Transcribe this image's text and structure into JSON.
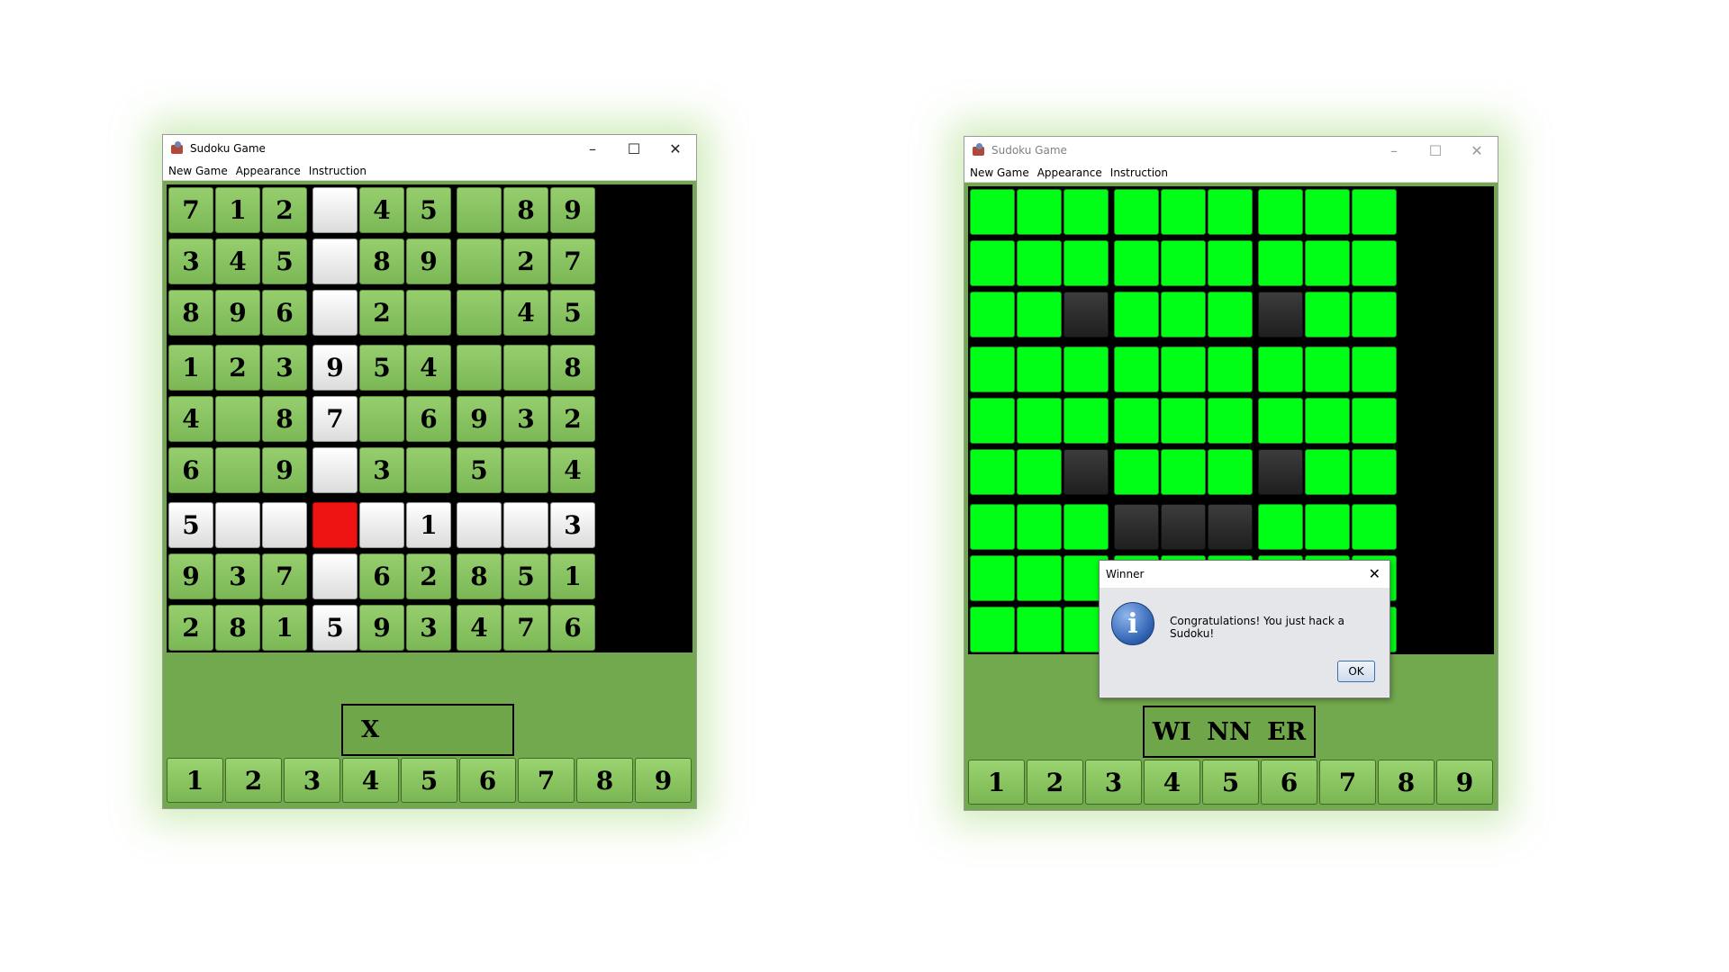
{
  "left_window": {
    "title": "Sudoku Game",
    "menu": [
      "New Game",
      "Appearance",
      "Instruction"
    ],
    "controls": [
      "–",
      "☐",
      "✕"
    ],
    "board": [
      [
        "7",
        "1",
        "2",
        "",
        "4",
        "5",
        "",
        "8",
        "9"
      ],
      [
        "3",
        "4",
        "5",
        "",
        "8",
        "9",
        "",
        "2",
        "7"
      ],
      [
        "8",
        "9",
        "6",
        "",
        "2",
        "",
        "",
        "4",
        "5"
      ],
      [
        "1",
        "2",
        "3",
        "9",
        "5",
        "4",
        "",
        "",
        "8"
      ],
      [
        "4",
        "",
        "8",
        "7",
        "",
        "6",
        "9",
        "3",
        "2"
      ],
      [
        "6",
        "",
        "9",
        "",
        "3",
        "",
        "5",
        "",
        "4"
      ],
      [
        "5",
        "",
        "",
        "",
        "",
        "1",
        "",
        "",
        "3"
      ],
      [
        "9",
        "3",
        "7",
        "",
        "6",
        "2",
        "8",
        "5",
        "1"
      ],
      [
        "2",
        "8",
        "1",
        "5",
        "9",
        "3",
        "4",
        "7",
        "6"
      ]
    ],
    "cell_styles": [
      [
        "g",
        "g",
        "g",
        "w",
        "g",
        "g",
        "g",
        "g",
        "g"
      ],
      [
        "g",
        "g",
        "g",
        "w",
        "g",
        "g",
        "g",
        "g",
        "g"
      ],
      [
        "g",
        "g",
        "g",
        "w",
        "g",
        "g",
        "g",
        "g",
        "g"
      ],
      [
        "g",
        "g",
        "g",
        "w",
        "g",
        "g",
        "g",
        "g",
        "g"
      ],
      [
        "g",
        "g",
        "g",
        "w",
        "g",
        "g",
        "g",
        "g",
        "g"
      ],
      [
        "g",
        "g",
        "g",
        "w",
        "g",
        "g",
        "g",
        "g",
        "g"
      ],
      [
        "w",
        "w",
        "w",
        "r",
        "w",
        "w",
        "w",
        "w",
        "w"
      ],
      [
        "g",
        "g",
        "g",
        "w",
        "g",
        "g",
        "g",
        "g",
        "g"
      ],
      [
        "g",
        "g",
        "g",
        "w",
        "g",
        "g",
        "g",
        "g",
        "g"
      ]
    ],
    "status_text": "X",
    "number_bar": [
      "1",
      "2",
      "3",
      "4",
      "5",
      "6",
      "7",
      "8",
      "9"
    ]
  },
  "right_window": {
    "title": "Sudoku Game",
    "menu": [
      "New Game",
      "Appearance",
      "Instruction"
    ],
    "controls": [
      "–",
      "☐",
      "✕"
    ],
    "cell_styles": [
      [
        "b",
        "b",
        "b",
        "b",
        "b",
        "b",
        "b",
        "b",
        "b"
      ],
      [
        "b",
        "b",
        "b",
        "b",
        "b",
        "b",
        "b",
        "b",
        "b"
      ],
      [
        "b",
        "b",
        "d",
        "b",
        "b",
        "b",
        "d",
        "b",
        "b"
      ],
      [
        "b",
        "b",
        "b",
        "b",
        "b",
        "b",
        "b",
        "b",
        "b"
      ],
      [
        "b",
        "b",
        "b",
        "b",
        "b",
        "b",
        "b",
        "b",
        "b"
      ],
      [
        "b",
        "b",
        "d",
        "b",
        "b",
        "b",
        "d",
        "b",
        "b"
      ],
      [
        "b",
        "b",
        "b",
        "d",
        "d",
        "d",
        "b",
        "b",
        "b"
      ],
      [
        "b",
        "b",
        "b",
        "b",
        "b",
        "b",
        "b",
        "b",
        "b"
      ],
      [
        "b",
        "b",
        "b",
        "b",
        "b",
        "b",
        "b",
        "b",
        "b"
      ]
    ],
    "status_parts": [
      "WI",
      "NN",
      "ER"
    ],
    "number_bar": [
      "1",
      "2",
      "3",
      "4",
      "5",
      "6",
      "7",
      "8",
      "9"
    ]
  },
  "dialog": {
    "title": "Winner",
    "close": "✕",
    "icon": "info-icon",
    "icon_glyph": "i",
    "message": "Congratulations! You just hack a Sudoku!",
    "ok_label": "OK"
  },
  "colors": {
    "background": "#ffffff",
    "panel_green": "#72a84e",
    "cell_green": "#8cc565",
    "bright_green": "#00ff16",
    "selected_red": "#ee1414",
    "dark_cell": "#2a2a2a"
  }
}
